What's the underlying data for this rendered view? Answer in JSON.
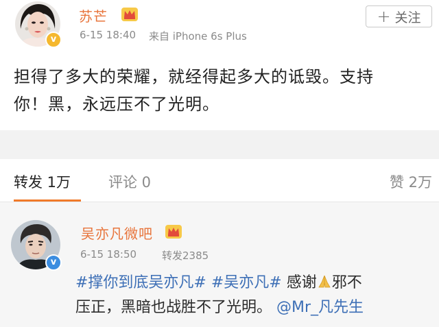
{
  "post": {
    "username": "苏芒",
    "time": "6-15 18:40",
    "source": "来自 iPhone 6s Plus",
    "follow_label": "关注",
    "text_line1": "担得了多大的荣耀，就经得起多大的诋毁。支持",
    "text_line2": "你！黑，永远压不了光明。"
  },
  "tabs": {
    "repost": "转发 1万",
    "comment": "评论 0",
    "like": "赞 2万"
  },
  "repost": {
    "username": "吴亦凡微吧",
    "time": "6-15 18:50",
    "repost_count": "转发2385",
    "topic1": "#撑你到底吴亦凡#",
    "topic2": "#吴亦凡#",
    "text_a": " 感谢",
    "text_b": "邪不",
    "text_line2": "压正，黑暗也战胜不了光明。",
    "mention": "@Mr_凡先生"
  },
  "colors": {
    "username": "#e8743b",
    "link": "#3d6fb6",
    "tab_accent": "#f07a2a",
    "vip_badge": "#f5b82e"
  },
  "icons": {
    "follow": "plus-icon",
    "vip": "crown-icon",
    "verified": "verified-badge-icon",
    "emoji": "pray-icon"
  }
}
